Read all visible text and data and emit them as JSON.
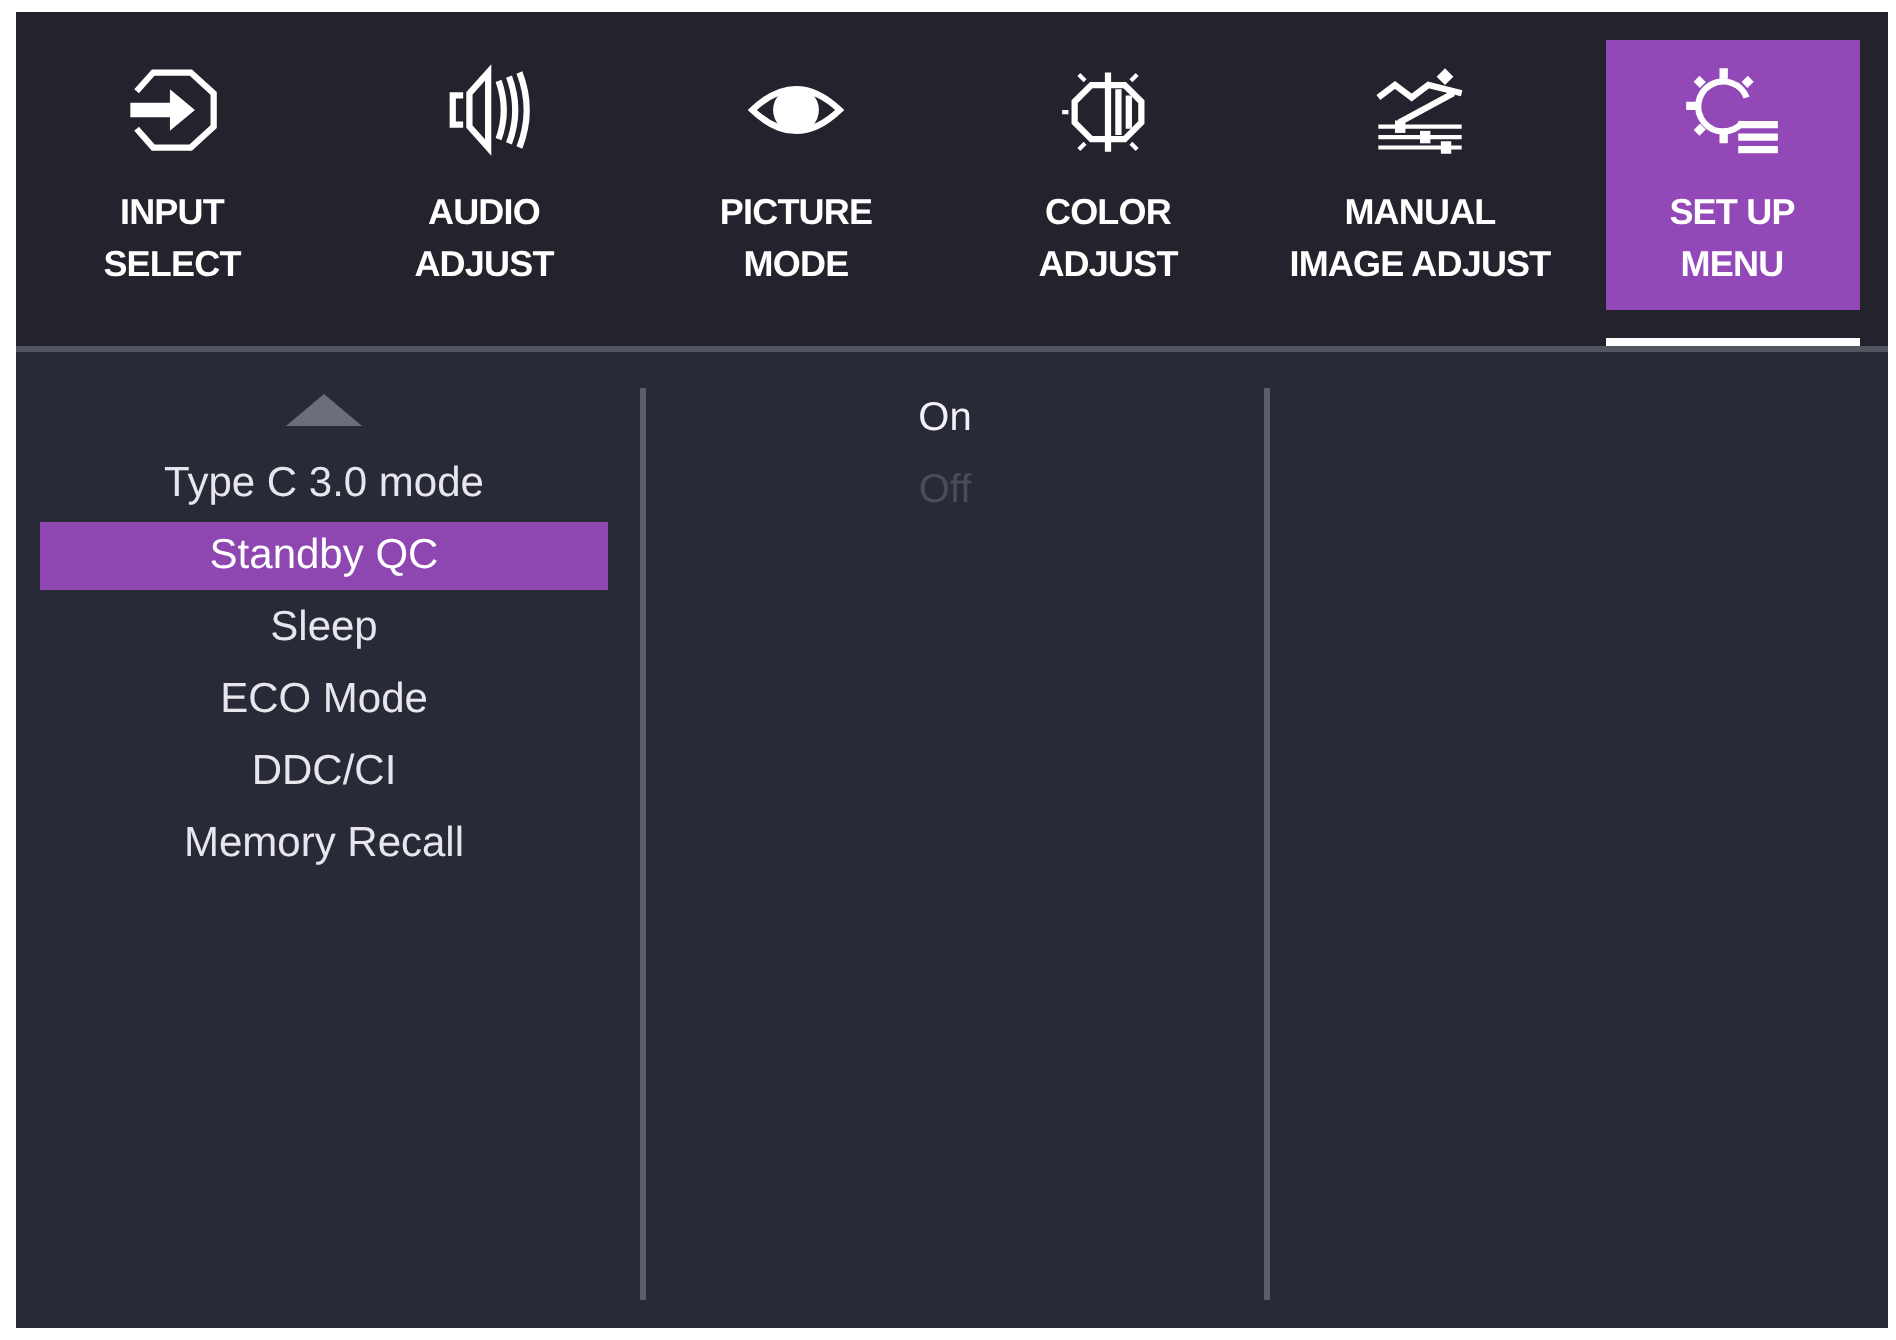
{
  "tabs": [
    {
      "kind": "input",
      "label": "INPUT\nSELECT",
      "selected": false
    },
    {
      "kind": "audio",
      "label": "AUDIO\nADJUST",
      "selected": false
    },
    {
      "kind": "picture",
      "label": "PICTURE\nMODE",
      "selected": false
    },
    {
      "kind": "color",
      "label": "COLOR\nADJUST",
      "selected": false
    },
    {
      "kind": "manual",
      "label": "MANUAL\nIMAGE ADJUST",
      "selected": false
    },
    {
      "kind": "setup",
      "label": "SET UP\nMENU",
      "selected": true
    }
  ],
  "menu": {
    "more_above": true,
    "items": [
      {
        "label": "Type C 3.0 mode",
        "selected": false
      },
      {
        "label": "Standby QC",
        "selected": true
      },
      {
        "label": "Sleep",
        "selected": false
      },
      {
        "label": "ECO Mode",
        "selected": false
      },
      {
        "label": "DDC/CI",
        "selected": false
      },
      {
        "label": "Memory Recall",
        "selected": false
      }
    ]
  },
  "options": [
    {
      "label": "On",
      "selected": true
    },
    {
      "label": "Off",
      "selected": false
    }
  ]
}
